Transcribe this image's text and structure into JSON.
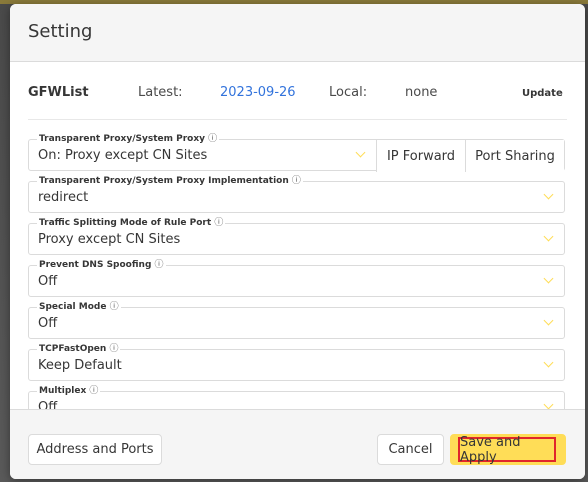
{
  "dialog": {
    "title": "Setting"
  },
  "gfwlist": {
    "name": "GFWList",
    "latest_label": "Latest:",
    "latest_value": "2023-09-26",
    "local_label": "Local:",
    "local_value": "none",
    "update_label": "Update"
  },
  "fields": {
    "transparent_proxy": {
      "label": "Transparent Proxy/System Proxy",
      "value": "On: Proxy except CN Sites",
      "ip_forward": "IP Forward",
      "port_sharing": "Port Sharing"
    },
    "implementation": {
      "label": "Transparent Proxy/System Proxy Implementation",
      "value": "redirect"
    },
    "traffic_splitting": {
      "label": "Traffic Splitting Mode of Rule Port",
      "value": "Proxy except CN Sites"
    },
    "dns_spoofing": {
      "label": "Prevent DNS Spoofing",
      "value": "Off"
    },
    "special_mode": {
      "label": "Special Mode",
      "value": "Off"
    },
    "tcp_fast_open": {
      "label": "TCPFastOpen",
      "value": "Keep Default"
    },
    "multiplex": {
      "label": "Multiplex",
      "value": "Off"
    }
  },
  "footer": {
    "address_ports": "Address and Ports",
    "cancel": "Cancel",
    "save_apply": "Save and Apply"
  },
  "colors": {
    "accent": "#ffdd57",
    "link": "#3273dc",
    "highlight": "#e0262b"
  },
  "icons": {
    "help": "question-circle-icon",
    "dropdown": "chevron-down-icon"
  }
}
